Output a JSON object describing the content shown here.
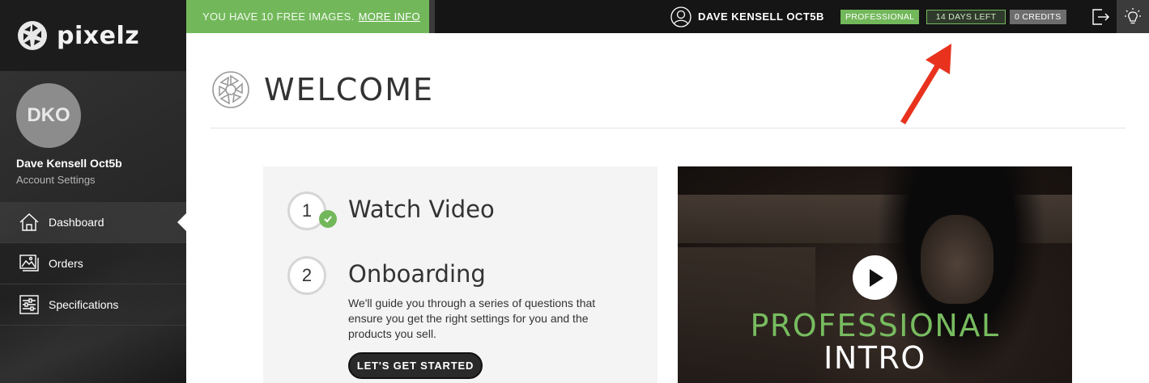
{
  "brand": {
    "name": "pixelz"
  },
  "profile": {
    "initials": "DKO",
    "name": "Dave Kensell Oct5b",
    "settings_link": "Account Settings"
  },
  "nav": {
    "items": [
      {
        "label": "Dashboard",
        "icon": "home-icon",
        "active": true
      },
      {
        "label": "Orders",
        "icon": "images-icon",
        "active": false
      },
      {
        "label": "Specifications",
        "icon": "sliders-icon",
        "active": false
      }
    ]
  },
  "topbar": {
    "promo_text": "YOU HAVE 10 FREE IMAGES.",
    "promo_link": "MORE INFO",
    "user_name": "DAVE KENSELL OCT5B",
    "plan_badge": "PROFESSIONAL",
    "days_badge": "14 DAYS LEFT",
    "credits_badge": "0 CREDITS",
    "logout_icon": "logout-icon",
    "theme_icon": "lightbulb-icon"
  },
  "main": {
    "title": "WELCOME",
    "steps": [
      {
        "number": "1",
        "title": "Watch Video",
        "completed": true
      },
      {
        "number": "2",
        "title": "Onboarding",
        "completed": false,
        "description": "We'll guide you through a series of questions that ensure you get the right settings for you and the products you sell.",
        "button": "LET'S GET STARTED"
      }
    ],
    "video": {
      "line1": "PROFESSIONAL",
      "line2": "INTRO",
      "icon": "play-icon"
    }
  },
  "colors": {
    "accent_green": "#72b85b",
    "sidebar_dark": "#1e1e1e",
    "annotation_red": "#e8321e"
  }
}
